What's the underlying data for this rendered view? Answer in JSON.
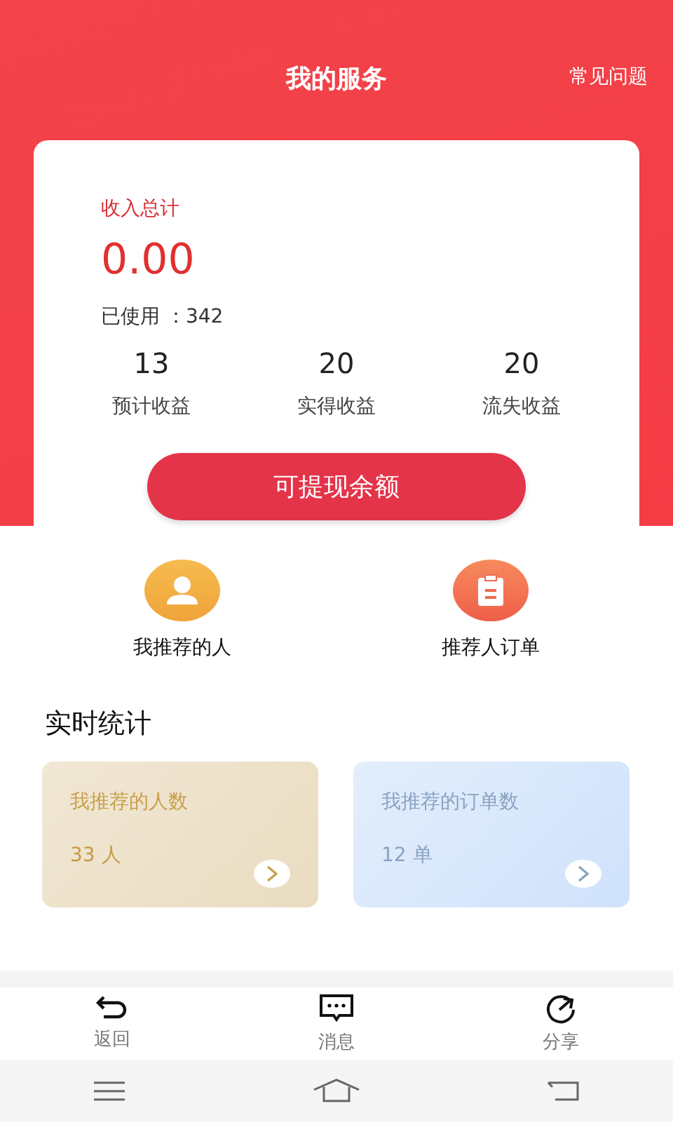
{
  "header": {
    "title": "我的服务",
    "faq_link": "常见问题"
  },
  "income_card": {
    "label": "收入总计",
    "amount": "0.00",
    "used": "已使用 ：342",
    "stats": [
      {
        "value": "13",
        "label": "预计收益"
      },
      {
        "value": "20",
        "label": "实得收益"
      },
      {
        "value": "20",
        "label": "流失收益"
      }
    ],
    "button": "可提现余额"
  },
  "shortcuts": [
    {
      "kind": "person",
      "label": "我推荐的人"
    },
    {
      "kind": "order",
      "label": "推荐人订单"
    }
  ],
  "stats_section": {
    "title": "实时统计",
    "cards": [
      {
        "kind": "people",
        "title": "我推荐的人数",
        "value": "33 人"
      },
      {
        "kind": "orders",
        "title": "我推荐的订单数",
        "value": "12 单"
      }
    ]
  },
  "tab_bar": [
    {
      "kind": "back",
      "label": "返回"
    },
    {
      "kind": "message",
      "label": "消息"
    },
    {
      "kind": "share",
      "label": "分享"
    }
  ]
}
